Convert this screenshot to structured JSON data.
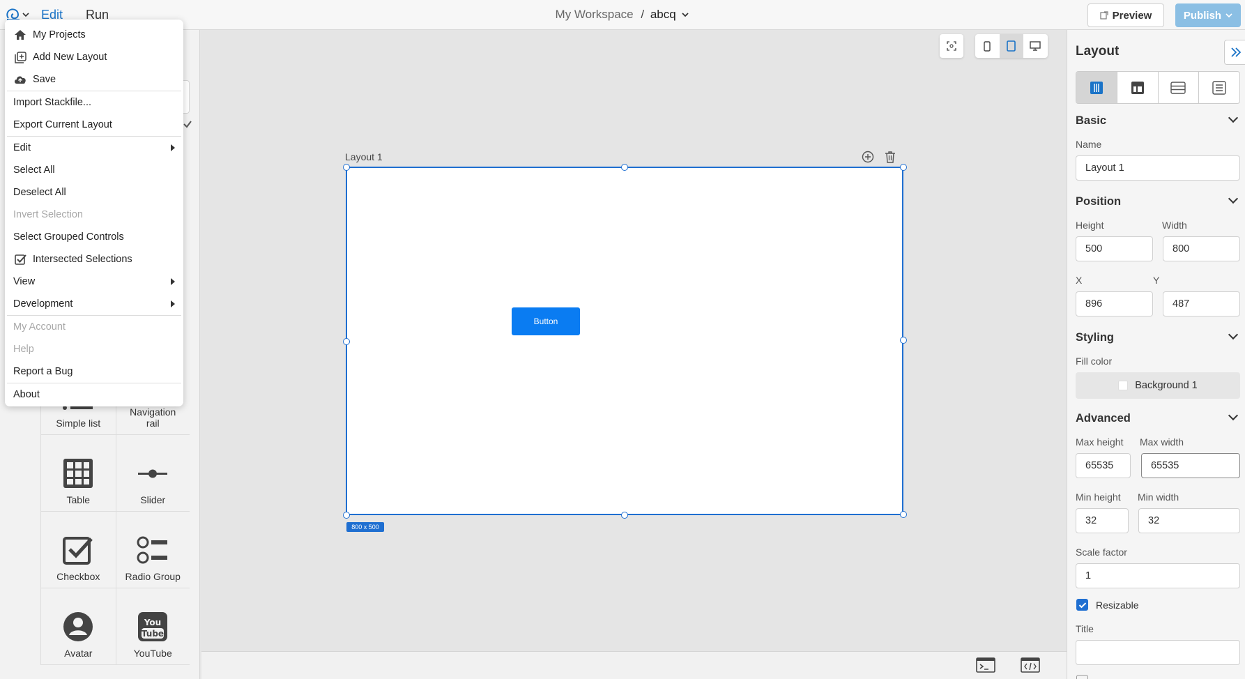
{
  "topbar": {
    "menu_edit": "Edit",
    "menu_run": "Run",
    "workspace": "My Workspace",
    "separator": "/",
    "project": "abcq",
    "preview_label": "Preview",
    "publish_label": "Publish"
  },
  "dropdown": {
    "items": [
      {
        "label": "My Projects",
        "icon": "home-icon"
      },
      {
        "label": "Add New Layout",
        "icon": "add-layout-icon"
      },
      {
        "label": "Save",
        "icon": "cloud-upload-icon"
      },
      {
        "label": "Import Stackfile..."
      },
      {
        "label": "Export Current Layout"
      },
      {
        "label": "Edit",
        "submenu": true
      },
      {
        "label": "Select All"
      },
      {
        "label": "Deselect All"
      },
      {
        "label": "Invert Selection",
        "disabled": true
      },
      {
        "label": "Select Grouped Controls"
      },
      {
        "label": "Intersected Selections",
        "icon": "checkbox-checked-icon"
      },
      {
        "label": "View",
        "submenu": true
      },
      {
        "label": "Development",
        "submenu": true
      },
      {
        "label": "My Account",
        "disabled": true
      },
      {
        "label": "Help",
        "disabled": true
      },
      {
        "label": "Report a Bug"
      },
      {
        "label": "About"
      }
    ]
  },
  "palette": {
    "items": [
      {
        "label": "Simple list",
        "icon": "list-icon"
      },
      {
        "label": "Navigation rail",
        "icon": "navigation-rail-icon"
      },
      {
        "label": "Table",
        "icon": "table-icon"
      },
      {
        "label": "Slider",
        "icon": "slider-icon"
      },
      {
        "label": "Checkbox",
        "icon": "checkbox-icon"
      },
      {
        "label": "Radio Group",
        "icon": "radio-group-icon"
      },
      {
        "label": "Avatar",
        "icon": "avatar-icon"
      },
      {
        "label": "YouTube",
        "icon": "youtube-icon"
      }
    ]
  },
  "canvas": {
    "layout_title": "Layout 1",
    "button_label": "Button",
    "size_badge": "800 x 500"
  },
  "right_panel": {
    "title": "Layout",
    "basic": {
      "heading": "Basic",
      "name_label": "Name",
      "name_value": "Layout 1"
    },
    "position": {
      "heading": "Position",
      "height_label": "Height",
      "height_value": "500",
      "width_label": "Width",
      "width_value": "800",
      "x_label": "X",
      "x_value": "896",
      "y_label": "Y",
      "y_value": "487"
    },
    "styling": {
      "heading": "Styling",
      "fill_label": "Fill color",
      "fill_value": "Background 1"
    },
    "advanced": {
      "heading": "Advanced",
      "max_height_label": "Max height",
      "max_height_value": "65535",
      "max_width_label": "Max width",
      "max_width_value": "65535",
      "min_height_label": "Min height",
      "min_height_value": "32",
      "min_width_label": "Min width",
      "min_width_value": "32",
      "scale_label": "Scale factor",
      "scale_value": "1",
      "resizable_label": "Resizable",
      "title_label": "Title",
      "title_value": ""
    }
  },
  "colors": {
    "accent": "#1f6fd1",
    "button_blue": "#0a7cf2",
    "publish_disabled": "#8bbfe4"
  }
}
